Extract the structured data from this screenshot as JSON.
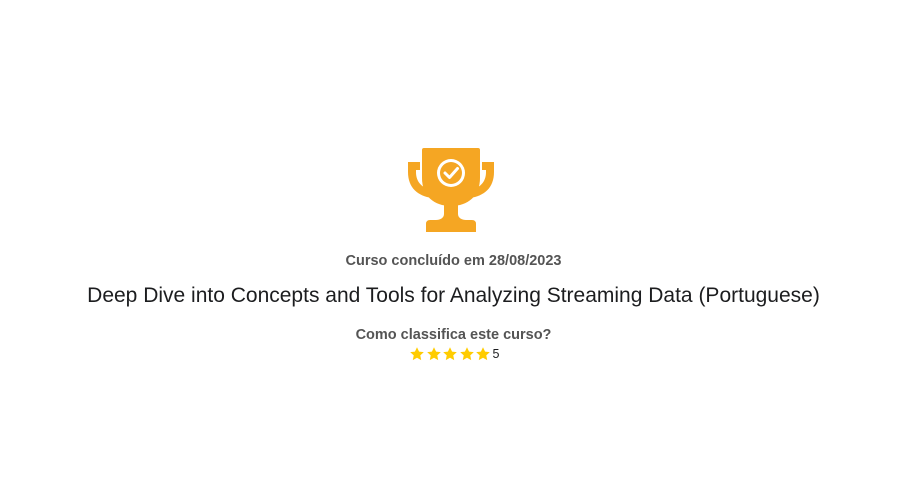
{
  "completion": {
    "label": "Curso concluído em 28/08/2023"
  },
  "course": {
    "title": "Deep Dive into Concepts and Tools for Analyzing Streaming Data (Portuguese)"
  },
  "rating": {
    "question": "Como classifica este curso?",
    "value": "5",
    "max": 5,
    "star_color": "#ffcc00"
  },
  "trophy": {
    "icon": "trophy-check-icon",
    "color": "#f5a623"
  }
}
